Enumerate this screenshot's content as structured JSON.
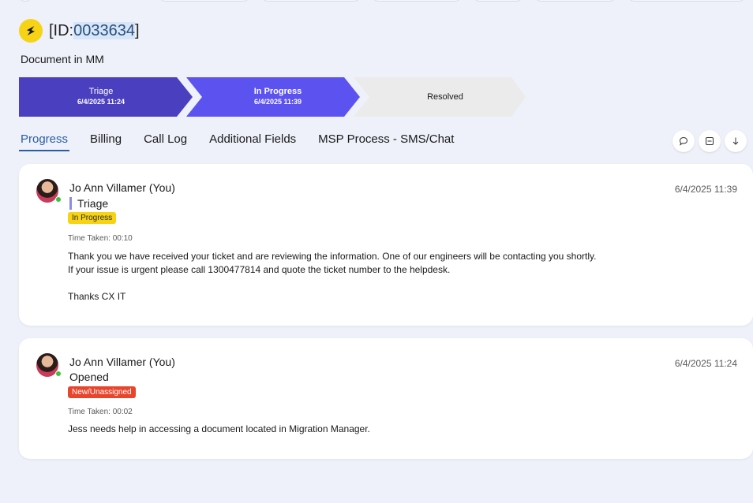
{
  "ticket": {
    "id_prefix": "[ID:",
    "id_number": "0033634",
    "id_suffix": "]",
    "subtitle": "Document in MM"
  },
  "stages": [
    {
      "name": "Triage",
      "date": "6/4/2025 11:24",
      "color": "#4a3fbf"
    },
    {
      "name": "In Progress",
      "date": "6/4/2025 11:39",
      "color": "#5c52f0"
    },
    {
      "name": "Resolved",
      "date": "",
      "color": "#ebebeb"
    }
  ],
  "tabs": [
    {
      "label": "Progress",
      "active": true
    },
    {
      "label": "Billing"
    },
    {
      "label": "Call Log"
    },
    {
      "label": "Additional Fields"
    },
    {
      "label": "MSP Process - SMS/Chat"
    }
  ],
  "tools": [
    "chat-icon",
    "collapse-icon",
    "download-icon"
  ],
  "entries": [
    {
      "author": "Jo Ann Villamer (You)",
      "stage": "Triage",
      "badge": "In Progress",
      "time_taken": "Time Taken: 00:10",
      "message": "Thank you we have received your ticket and are reviewing the information. One of our engineers will be contacting you shortly.\nIf your issue is urgent please call 1300477814 and quote the ticket number to the helpdesk.\n\nThanks CX IT",
      "timestamp": "6/4/2025 11:39"
    },
    {
      "author": "Jo Ann Villamer (You)",
      "stage": "Opened",
      "badge": "New/Unassigned",
      "time_taken": "Time Taken: 00:02",
      "message": "Jess needs help in accessing a document located in Migration Manager.",
      "timestamp": "6/4/2025 11:24"
    }
  ]
}
